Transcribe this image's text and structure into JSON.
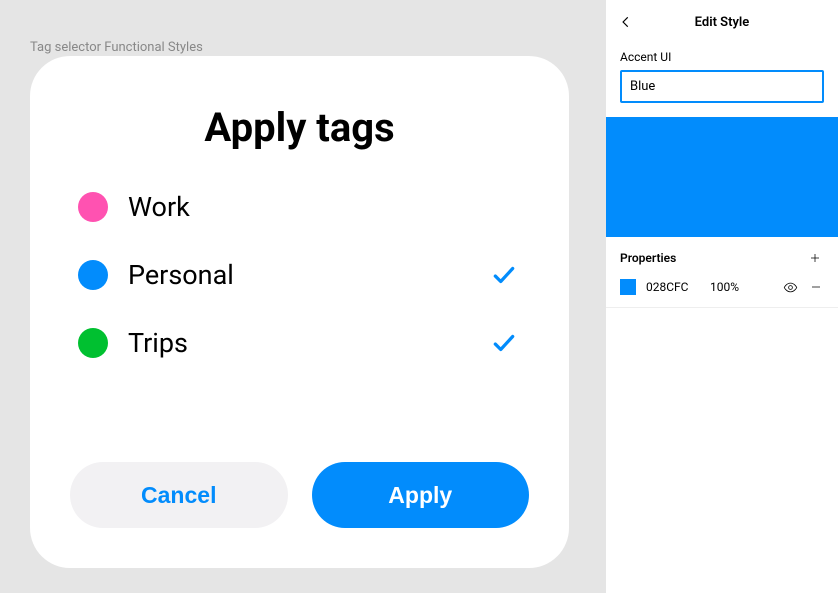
{
  "canvas": {
    "label": "Tag selector Functional Styles",
    "card": {
      "title": "Apply tags",
      "tags": [
        {
          "name": "Work",
          "color": "#FF52B1",
          "selected": false
        },
        {
          "name": "Personal",
          "color": "#028CFC",
          "selected": true
        },
        {
          "name": "Trips",
          "color": "#00C030",
          "selected": true
        }
      ],
      "cancel_label": "Cancel",
      "apply_label": "Apply"
    }
  },
  "panel": {
    "title": "Edit Style",
    "section_label": "Accent UI",
    "name_value": "Blue",
    "preview_color": "#028CFC",
    "properties": {
      "title": "Properties",
      "rows": [
        {
          "hex": "028CFC",
          "opacity": "100%",
          "swatch": "#028CFC"
        }
      ]
    }
  }
}
